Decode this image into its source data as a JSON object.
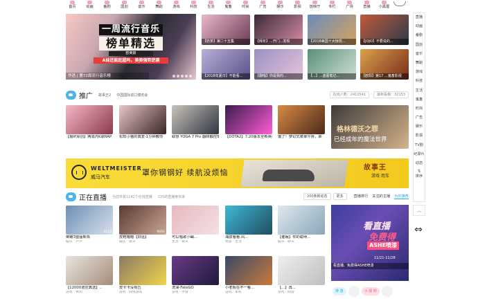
{
  "nav": {
    "items": [
      {
        "label": "首页",
        "color": "#f4a3bd"
      },
      {
        "label": "动画",
        "color": "#f4a3bd"
      },
      {
        "label": "番剧",
        "color": "#f4a3bd"
      },
      {
        "label": "国创",
        "color": "#f4a3bd"
      },
      {
        "label": "音乐",
        "color": "#f4a3bd"
      },
      {
        "label": "舞蹈",
        "color": "#f4a3bd"
      },
      {
        "label": "游戏",
        "color": "#f4a3bd"
      },
      {
        "label": "科技",
        "color": "#f4a3bd"
      },
      {
        "label": "生活",
        "color": "#f4a3bd"
      },
      {
        "label": "鬼畜",
        "color": "#f4a3bd"
      },
      {
        "label": "时尚",
        "color": "#f4a3bd"
      },
      {
        "label": "广告",
        "color": "#f4a3bd"
      },
      {
        "label": "娱乐",
        "color": "#f4a3bd"
      },
      {
        "label": "影视",
        "color": "#f4a3bd"
      },
      {
        "label": "放映厅",
        "color": "#f4a3bd"
      },
      {
        "label": "专栏",
        "color": "#f4a3bd"
      },
      {
        "label": "广场",
        "color": "#f4a3bd"
      },
      {
        "label": "直播",
        "color": "#f4a3bd"
      },
      {
        "label": "小黑屋",
        "color": "#f4a3bd"
      }
    ]
  },
  "sidebar": {
    "items": [
      "直播",
      "动画",
      "番剧",
      "国创",
      "音乐",
      "舞蹈",
      "游戏",
      "科技",
      "生活",
      "鬼畜",
      "时尚",
      "广告",
      "娱乐",
      "影视",
      "TV剧",
      "纪录片",
      "动态"
    ],
    "sort_label": "排序"
  },
  "banner": {
    "line1": "一周流行音乐",
    "line2": "榜单精选",
    "line3": "欧美篇",
    "line4": "A妹还能赶超吗，美美强势逆袭",
    "caption": "华语 | 第72周流行音乐榜"
  },
  "top_cards": [
    {
      "ovl": "【奶茶】第二十五集",
      "color1": "#e9b8c9",
      "color2": "#6a3a55"
    },
    {
      "ovl": "【拜年】...开门...发现",
      "color1": "#3a2a38",
      "color2": "#d78ca6"
    },
    {
      "ovl": "【2018美国十大惊现...",
      "color1": "#6a8cc0",
      "color2": "#d6a35b"
    },
    {
      "ovl": "【JOJO】不要说的...",
      "color1": "#c05a3c",
      "color2": "#2c3a4a"
    },
    {
      "ovl": "【2018年夏日】不能看...",
      "color1": "#b7b0d8",
      "color2": "#5c4f8a"
    },
    {
      "ovl": "【翻唱】你是我的...",
      "color1": "#9a8fc4",
      "color2": "#e6c4d9"
    },
    {
      "ovl": "【...】...盗墓笔记...",
      "color1": "#5a8f7a",
      "color2": "#cfe0d4"
    },
    {
      "ovl": "【欧阳】第17 ...鬼畜影视",
      "color1": "#d9a24a",
      "color2": "#7a2a1c"
    }
  ],
  "promo_section": {
    "title": "推广",
    "links": [
      "故事王2",
      "中国国际进口博览会"
    ],
    "online_label": "在线人数：",
    "online_count": "2411541",
    "latest_label": "最新投稿：",
    "latest_count": "32153"
  },
  "promo_cards": [
    {
      "title": "【摄IP原创】两周内K歌RAP",
      "color1": "#f6b7c7",
      "color2": "#8b3a4a",
      "tag": ""
    },
    {
      "title": "松软小猫的真爱·1分钟教你",
      "color1": "#e8c6c6",
      "color2": "#3a2626",
      "tag": ""
    },
    {
      "title": "联想 YOGA 7 Pro 翻转触控笔",
      "color1": "#c9c3bb",
      "color2": "#2f3540",
      "tag": ""
    },
    {
      "title": "【DOTA2】7.20版本全新英雄",
      "color1": "#3a1b4f",
      "color2": "#ff5dd2",
      "tag": ""
    },
    {
      "title": "饿了！梦幻式菜单牛排，来",
      "color1": "#d98a47",
      "color2": "#4a2a18",
      "tag": ""
    },
    {
      "title": "已经成年的魔法世界",
      "color1": "#3c3a3a",
      "color2": "#d6b48b",
      "tag": "格林德沃之罪"
    }
  ],
  "ad": {
    "brand_en": "WELTMEISTER",
    "brand_cn": "威马汽车",
    "slogan": "罩你钢钢好  续航没烦恼",
    "partner": "故事王",
    "partner_sub": "游戏 用车"
  },
  "live_section": {
    "title": "正在直播",
    "sub1": "当前共有1142个在线直播",
    "sub2": "235的直播等你来",
    "refresh_label": "200条新动态",
    "more_label": "更多",
    "tabs": [
      "直播排行",
      "关注的主播",
      "为你推荐"
    ],
    "active_tab": "为你推荐"
  },
  "live_cards": [
    {
      "title": "荣耀3蓝猛新陈",
      "tag": "娱乐 · 户外",
      "color1": "#6e8fb6",
      "color2": "#d9e0ea",
      "views": "3213"
    },
    {
      "title": "皮鞋暗暗【好运】",
      "tag": "娱乐 · 聊天",
      "color1": "#5b3a33",
      "color2": "#c9a493",
      "views": "9692"
    },
    {
      "title": "可以唱歌小幽...",
      "tag": "生活 · 聊天",
      "color1": "#e6b9c0",
      "color2": "#f3e1e3",
      "views": ""
    },
    {
      "title": "海拔看看.风...",
      "tag": "绘画 · 生活",
      "color1": "#3fb8d6",
      "color2": "#1f4d60",
      "views": ""
    },
    {
      "title": "【催眠】你的聪明...",
      "tag": "娱乐 · 聊天",
      "color1": "#dfe8ef",
      "color2": "#8aa6b8",
      "views": ""
    },
    {
      "title": "【12000道应真选】..",
      "tag": "游戏 · 休闲",
      "color1": "#e9e4df",
      "color2": "#a48d7a",
      "views": ""
    },
    {
      "title": "皮卡卡没有丘",
      "tag": "游戏 · 网络游戏",
      "color1": "#8a7a66",
      "color2": "#f0d44a",
      "views": ""
    },
    {
      "title": "洗澡·FateGO",
      "tag": "游戏 · 手游",
      "color1": "#6a3a88",
      "color2": "#1f1a3a",
      "views": ""
    },
    {
      "title": "小老板在不一看...",
      "tag": "游戏 · 单机",
      "color1": "#3a4a6a",
      "color2": "#c97a3a",
      "views": ""
    },
    {
      "title": "【...】再...",
      "tag": "游戏 · 网游",
      "color1": "#efefef",
      "color2": "#bfbfbf",
      "views": ""
    }
  ],
  "live_promo": {
    "line1": "看直播",
    "line2": "免费得",
    "line3": "ASHE喷漆",
    "line4": "11/21-11/28",
    "caption": "看直播、免费得ASHE喷漆",
    "btn1": "排 落",
    "btn2": "小 视 频"
  }
}
